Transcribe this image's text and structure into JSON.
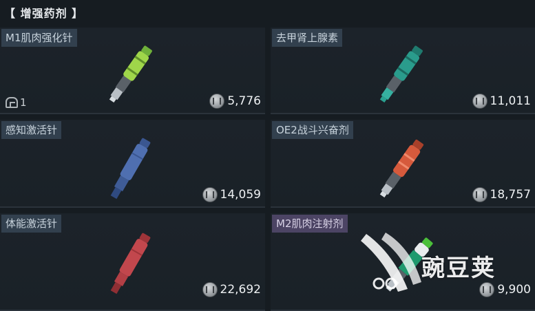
{
  "section": {
    "title": "【 增强药剂 】"
  },
  "items": [
    {
      "name": "M1肌肉强化针",
      "price": "5,776",
      "count": "1",
      "color": "#9fd64a",
      "name_style": "default"
    },
    {
      "name": "去甲肾上腺素",
      "price": "11,011",
      "color": "#2a9c8c",
      "name_style": "default"
    },
    {
      "name": "感知激活针",
      "price": "14,059",
      "color": "#4f6fb0",
      "name_style": "default"
    },
    {
      "name": "OE2战斗兴奋剂",
      "price": "18,757",
      "color": "#d65a3c",
      "name_style": "default"
    },
    {
      "name": "体能激活针",
      "price": "22,692",
      "color": "#c2474d",
      "name_style": "default"
    },
    {
      "name": "M2肌肉注射剂",
      "price": "9,900",
      "color": "#1f9a6e",
      "name_style": "purple"
    }
  ],
  "icons": {
    "currency": "coin-icon",
    "count": "container-count-icon"
  },
  "watermark": {
    "text": "豌豆荚"
  }
}
